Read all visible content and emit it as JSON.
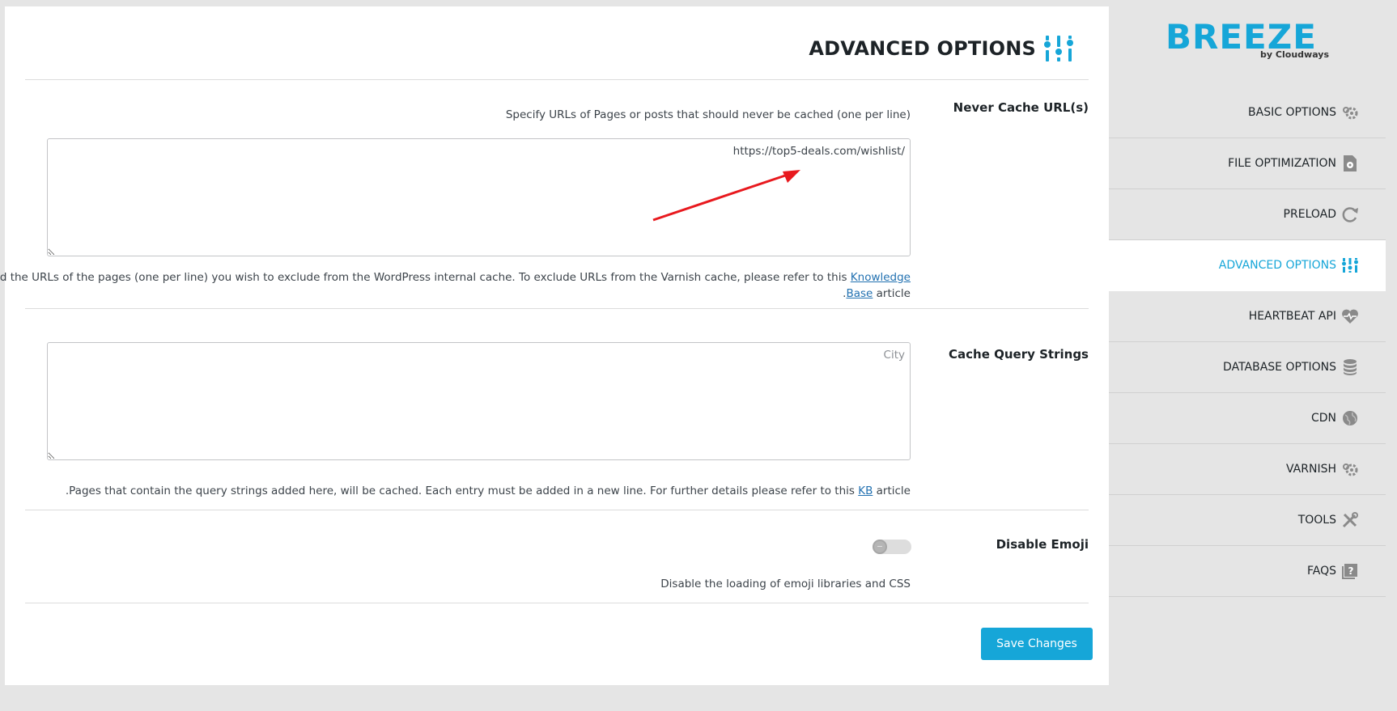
{
  "page": {
    "title": "ADVANCED OPTIONS"
  },
  "brand": {
    "name": "BREEZE",
    "by": "by Cloudways",
    "accent": "#16a6d8"
  },
  "sections": {
    "never_cache": {
      "label": "Never Cache URL(s)",
      "hint": "Specify URLs of Pages or posts that should never be cached (one per line)",
      "value": "/https://top5-deals.com/wishlist",
      "desc_pre": "Add the URLs of the pages (one per line) you wish to exclude from the WordPress internal cache. To exclude URLs from the Varnish cache, please refer to this",
      "desc_link1": "Knowledge",
      "desc_line2_pre": ".",
      "desc_link2": "Base",
      "desc_post": "article"
    },
    "query_strings": {
      "label": "Cache Query Strings",
      "placeholder": "City",
      "desc_pre": ".Pages that contain the query strings added here, will be cached. Each entry must be added in a new line. For further details please refer to this",
      "desc_link": "KB",
      "desc_post": "article"
    },
    "emoji": {
      "label": "Disable Emoji",
      "desc": "Disable the loading of emoji libraries and CSS",
      "enabled": false
    }
  },
  "save_label": "Save Changes",
  "nav": {
    "items": [
      {
        "label": "BASIC OPTIONS",
        "icon": "gear-icon"
      },
      {
        "label": "FILE OPTIMIZATION",
        "icon": "file-gear-icon"
      },
      {
        "label": "PRELOAD",
        "icon": "refresh-icon"
      },
      {
        "label": "ADVANCED OPTIONS",
        "icon": "sliders-icon",
        "active": true
      },
      {
        "label": "HEARTBEAT API",
        "icon": "heart-icon"
      },
      {
        "label": "DATABASE OPTIONS",
        "icon": "database-icon"
      },
      {
        "label": "CDN",
        "icon": "globe-icon"
      },
      {
        "label": "VARNISH",
        "icon": "gear-icon"
      },
      {
        "label": "TOOLS",
        "icon": "tools-icon"
      },
      {
        "label": "FAQS",
        "icon": "question-icon"
      }
    ]
  }
}
